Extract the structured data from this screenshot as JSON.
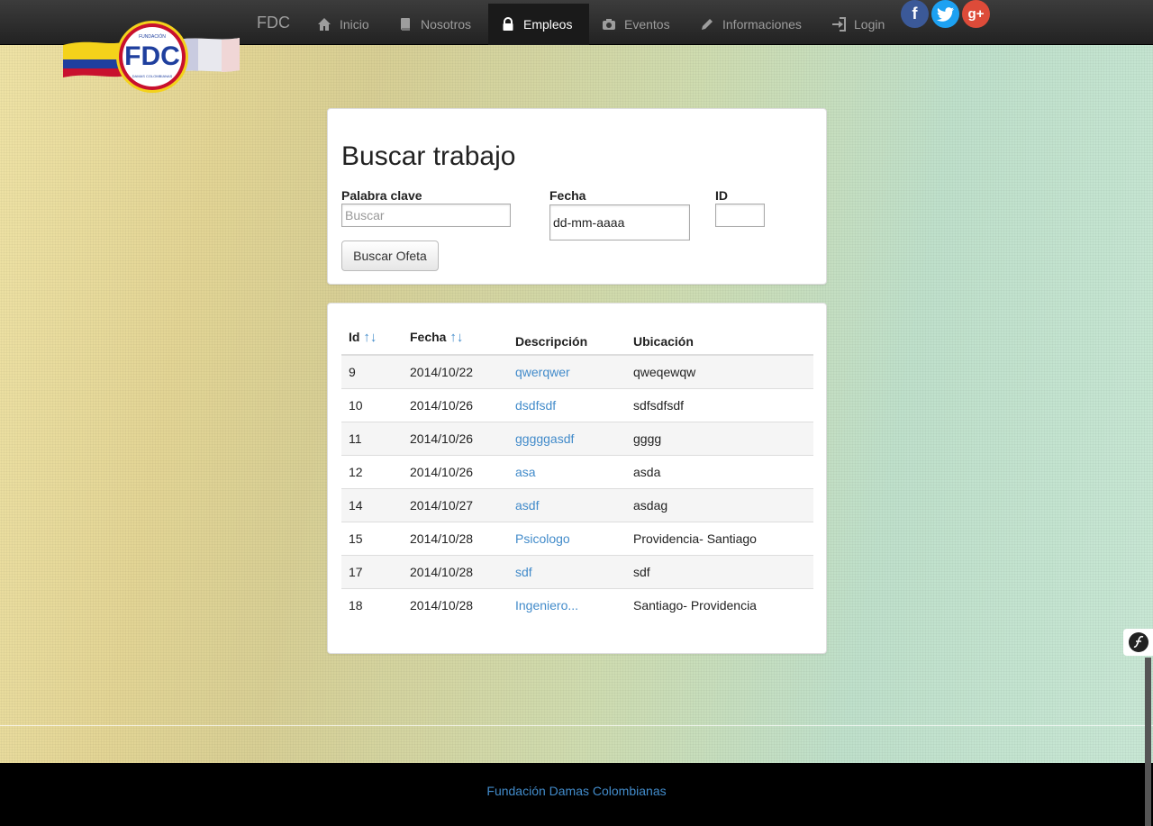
{
  "navbar": {
    "brand": "FDC",
    "items": [
      {
        "label": "Inicio",
        "icon": "home-icon"
      },
      {
        "label": "Nosotros",
        "icon": "book-icon"
      },
      {
        "label": "Empleos",
        "icon": "lock-icon",
        "active": true
      },
      {
        "label": "Eventos",
        "icon": "camera-icon"
      },
      {
        "label": "Informaciones",
        "icon": "pencil-icon"
      },
      {
        "label": "Login",
        "icon": "login-icon"
      }
    ],
    "social": [
      {
        "label": "f",
        "name": "facebook-icon",
        "color": "#3b5998"
      },
      {
        "label": "t",
        "name": "twitter-icon",
        "color": "#1da1f2"
      },
      {
        "label": "g+",
        "name": "google-plus-icon",
        "color": "#dd4b39"
      }
    ]
  },
  "logo": {
    "text": "FDC",
    "subtext_top": "FUNDACIÓN",
    "subtext_bottom": "DAMAS COLOMBIANAS"
  },
  "search": {
    "title": "Buscar trabajo",
    "keyword_label": "Palabra clave",
    "keyword_placeholder": "Buscar",
    "date_label": "Fecha",
    "date_value": "dd-mm-aaaa",
    "id_label": "ID",
    "button": "Buscar Ofeta"
  },
  "table": {
    "columns": {
      "id": "Id",
      "fecha": "Fecha",
      "descripcion": "Descripción",
      "ubicacion": "Ubicación"
    },
    "sort_up": "↑",
    "sort_down": "↓",
    "rows": [
      {
        "id": "9",
        "fecha": "2014/10/22",
        "descripcion": "qwerqwer",
        "ubicacion": "qweqewqw"
      },
      {
        "id": "10",
        "fecha": "2014/10/26",
        "descripcion": "dsdfsdf",
        "ubicacion": "sdfsdfsdf"
      },
      {
        "id": "11",
        "fecha": "2014/10/26",
        "descripcion": "gggggasdf",
        "ubicacion": "gggg"
      },
      {
        "id": "12",
        "fecha": "2014/10/26",
        "descripcion": "asa",
        "ubicacion": "asda"
      },
      {
        "id": "14",
        "fecha": "2014/10/27",
        "descripcion": "asdf",
        "ubicacion": "asdag"
      },
      {
        "id": "15",
        "fecha": "2014/10/28",
        "descripcion": "Psicologo",
        "ubicacion": "Providencia- Santiago"
      },
      {
        "id": "17",
        "fecha": "2014/10/28",
        "descripcion": "sdf",
        "ubicacion": "sdf"
      },
      {
        "id": "18",
        "fecha": "2014/10/28",
        "descripcion": "Ingeniero...",
        "ubicacion": "Santiago- Providencia"
      }
    ]
  },
  "footer": {
    "link": "Fundación Damas Colombianas"
  },
  "colors": {
    "link": "#428bca",
    "navbar": "#222222",
    "footer": "#000000"
  }
}
